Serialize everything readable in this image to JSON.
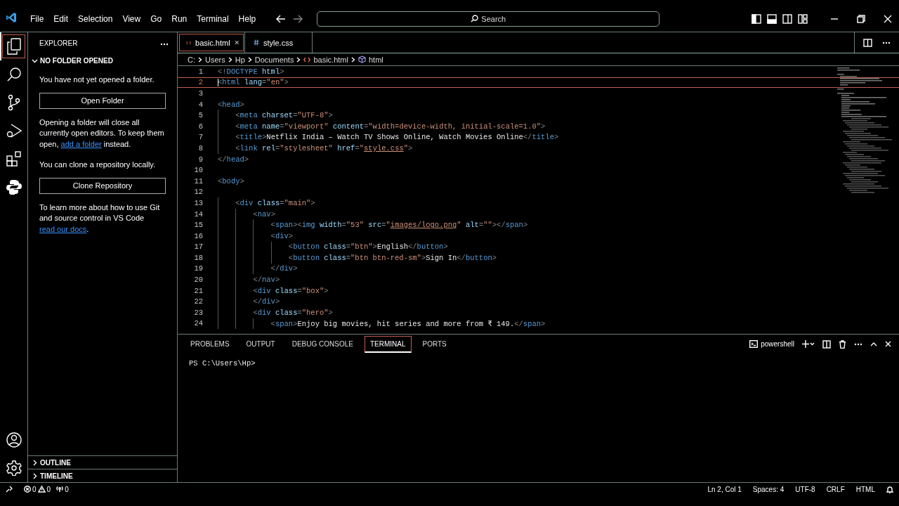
{
  "menu": [
    "File",
    "Edit",
    "Selection",
    "View",
    "Go",
    "Run",
    "Terminal",
    "Help"
  ],
  "search": {
    "placeholder": "Search"
  },
  "activity_bar": [
    {
      "kind": "files",
      "selected": true
    },
    {
      "kind": "search",
      "selected": false
    },
    {
      "kind": "source-control",
      "selected": false
    },
    {
      "kind": "run-debug",
      "selected": false
    },
    {
      "kind": "extensions",
      "selected": false
    },
    {
      "kind": "python",
      "selected": false
    }
  ],
  "activity_bar_bottom": [
    {
      "kind": "account"
    },
    {
      "kind": "settings"
    }
  ],
  "sidebar": {
    "title": "EXPLORER",
    "section": {
      "title": "NO FOLDER OPENED",
      "expanded": true
    },
    "blocks": [
      {
        "kind": "paragraph",
        "parts": [
          {
            "text": "You have not yet opened a folder."
          }
        ]
      },
      {
        "kind": "button",
        "label": "Open Folder"
      },
      {
        "kind": "paragraph",
        "parts": [
          {
            "text": "Opening a folder will close all currently open editors. To keep them open, "
          },
          {
            "link": "add a folder"
          },
          {
            "text": " instead."
          }
        ]
      },
      {
        "kind": "paragraph",
        "parts": [
          {
            "text": "You can clone a repository locally."
          }
        ]
      },
      {
        "kind": "button",
        "label": "Clone Repository"
      },
      {
        "kind": "paragraph",
        "parts": [
          {
            "text": "To learn more about how to use Git and source control in VS Code "
          },
          {
            "link": "read our docs"
          },
          {
            "text": "."
          }
        ]
      }
    ],
    "collapsed_sections": [
      {
        "title": "OUTLINE",
        "expanded": false
      },
      {
        "title": "TIMELINE",
        "expanded": false
      }
    ]
  },
  "tabs": [
    {
      "label": "basic.html",
      "kind": "html",
      "selected": true
    },
    {
      "label": "style.css",
      "kind": "css",
      "selected": false
    }
  ],
  "breadcrumbs": [
    {
      "label": "C:"
    },
    {
      "label": "Users"
    },
    {
      "label": "Hp"
    },
    {
      "label": "Documents"
    },
    {
      "label": "basic.html",
      "kind": "html"
    },
    {
      "label": "html",
      "kind": "element"
    }
  ],
  "code": [
    {
      "number": "1",
      "current": false,
      "tokens": [
        {
          "kind": "punct",
          "text": "<!"
        },
        {
          "kind": "tag",
          "text": "DOCTYPE"
        },
        {
          "kind": "attr",
          "text": " html"
        },
        {
          "kind": "punct",
          "text": ">"
        }
      ]
    },
    {
      "number": "2",
      "current": true,
      "tokens": [
        {
          "kind": "punct",
          "text": "<"
        },
        {
          "kind": "tag",
          "text": "html"
        },
        {
          "kind": "attr",
          "text": " lang"
        },
        {
          "kind": "punct",
          "text": "="
        },
        {
          "kind": "string",
          "text": "\"en\""
        },
        {
          "kind": "punct",
          "text": ">"
        }
      ]
    },
    {
      "number": "3",
      "current": false
    },
    {
      "number": "4",
      "current": false,
      "tokens": [
        {
          "kind": "punct",
          "text": "<"
        },
        {
          "kind": "tag",
          "text": "head"
        },
        {
          "kind": "punct",
          "text": ">"
        }
      ]
    },
    {
      "number": "5",
      "current": false,
      "tokens": [
        {
          "kind": "punct",
          "text": "    <"
        },
        {
          "kind": "tag",
          "text": "meta"
        },
        {
          "kind": "attr",
          "text": " charset"
        },
        {
          "kind": "punct",
          "text": "="
        },
        {
          "kind": "string",
          "text": "\"UTF-8\""
        },
        {
          "kind": "punct",
          "text": ">"
        }
      ]
    },
    {
      "number": "6",
      "current": false,
      "tokens": [
        {
          "kind": "punct",
          "text": "    <"
        },
        {
          "kind": "tag",
          "text": "meta"
        },
        {
          "kind": "attr",
          "text": " name"
        },
        {
          "kind": "punct",
          "text": "="
        },
        {
          "kind": "string",
          "text": "\"viewport\""
        },
        {
          "kind": "attr",
          "text": " content"
        },
        {
          "kind": "punct",
          "text": "="
        },
        {
          "kind": "string",
          "text": "\"width=device-width, initial-scale=1.0\""
        },
        {
          "kind": "punct",
          "text": ">"
        }
      ]
    },
    {
      "number": "7",
      "current": false,
      "tokens": [
        {
          "kind": "punct",
          "text": "    <"
        },
        {
          "kind": "tag",
          "text": "title"
        },
        {
          "kind": "punct",
          "text": ">"
        },
        {
          "kind": "text",
          "text": "Netflix India – Watch TV Shows Online, Watch Movies Online"
        },
        {
          "kind": "punct",
          "text": "</"
        },
        {
          "kind": "tag",
          "text": "title"
        },
        {
          "kind": "punct",
          "text": ">"
        }
      ]
    },
    {
      "number": "8",
      "current": false,
      "tokens": [
        {
          "kind": "punct",
          "text": "    <"
        },
        {
          "kind": "tag",
          "text": "link"
        },
        {
          "kind": "attr",
          "text": " rel"
        },
        {
          "kind": "punct",
          "text": "="
        },
        {
          "kind": "string",
          "text": "\"stylesheet\""
        },
        {
          "kind": "attr",
          "text": " href"
        },
        {
          "kind": "punct",
          "text": "="
        },
        {
          "kind": "string",
          "text": "\""
        },
        {
          "kind": "link",
          "text": "style.css"
        },
        {
          "kind": "string",
          "text": "\""
        },
        {
          "kind": "punct",
          "text": ">"
        }
      ]
    },
    {
      "number": "9",
      "current": false,
      "tokens": [
        {
          "kind": "punct",
          "text": "</"
        },
        {
          "kind": "tag",
          "text": "head"
        },
        {
          "kind": "punct",
          "text": ">"
        }
      ]
    },
    {
      "number": "10",
      "current": false
    },
    {
      "number": "11",
      "current": false,
      "tokens": [
        {
          "kind": "punct",
          "text": "<"
        },
        {
          "kind": "tag",
          "text": "body"
        },
        {
          "kind": "punct",
          "text": ">"
        }
      ]
    },
    {
      "number": "12",
      "current": false
    },
    {
      "number": "13",
      "current": false,
      "tokens": [
        {
          "kind": "punct",
          "text": "    <"
        },
        {
          "kind": "tag",
          "text": "div"
        },
        {
          "kind": "attr",
          "text": " class"
        },
        {
          "kind": "punct",
          "text": "="
        },
        {
          "kind": "string",
          "text": "\"main\""
        },
        {
          "kind": "punct",
          "text": ">"
        }
      ]
    },
    {
      "number": "14",
      "current": false,
      "tokens": [
        {
          "kind": "punct",
          "text": "        <"
        },
        {
          "kind": "tag",
          "text": "nav"
        },
        {
          "kind": "punct",
          "text": ">"
        }
      ]
    },
    {
      "number": "15",
      "current": false,
      "tokens": [
        {
          "kind": "punct",
          "text": "            <"
        },
        {
          "kind": "tag",
          "text": "span"
        },
        {
          "kind": "punct",
          "text": "><"
        },
        {
          "kind": "tag",
          "text": "img"
        },
        {
          "kind": "attr",
          "text": " width"
        },
        {
          "kind": "punct",
          "text": "="
        },
        {
          "kind": "string",
          "text": "\"53\""
        },
        {
          "kind": "attr",
          "text": " src"
        },
        {
          "kind": "punct",
          "text": "="
        },
        {
          "kind": "string",
          "text": "\""
        },
        {
          "kind": "link",
          "text": "images/logo.png"
        },
        {
          "kind": "string",
          "text": "\""
        },
        {
          "kind": "attr",
          "text": " alt"
        },
        {
          "kind": "punct",
          "text": "="
        },
        {
          "kind": "string",
          "text": "\"\""
        },
        {
          "kind": "punct",
          "text": "></"
        },
        {
          "kind": "tag",
          "text": "span"
        },
        {
          "kind": "punct",
          "text": ">"
        }
      ]
    },
    {
      "number": "16",
      "current": false,
      "tokens": [
        {
          "kind": "punct",
          "text": "            <"
        },
        {
          "kind": "tag",
          "text": "div"
        },
        {
          "kind": "punct",
          "text": ">"
        }
      ]
    },
    {
      "number": "17",
      "current": false,
      "tokens": [
        {
          "kind": "punct",
          "text": "                <"
        },
        {
          "kind": "tag",
          "text": "button"
        },
        {
          "kind": "attr",
          "text": " class"
        },
        {
          "kind": "punct",
          "text": "="
        },
        {
          "kind": "string",
          "text": "\"btn\""
        },
        {
          "kind": "punct",
          "text": ">"
        },
        {
          "kind": "text",
          "text": "English"
        },
        {
          "kind": "punct",
          "text": "</"
        },
        {
          "kind": "tag",
          "text": "button"
        },
        {
          "kind": "punct",
          "text": ">"
        }
      ]
    },
    {
      "number": "18",
      "current": false,
      "tokens": [
        {
          "kind": "punct",
          "text": "                <"
        },
        {
          "kind": "tag",
          "text": "button"
        },
        {
          "kind": "attr",
          "text": " class"
        },
        {
          "kind": "punct",
          "text": "="
        },
        {
          "kind": "string",
          "text": "\"btn btn-red-sm\""
        },
        {
          "kind": "punct",
          "text": ">"
        },
        {
          "kind": "text",
          "text": "Sign In"
        },
        {
          "kind": "punct",
          "text": "</"
        },
        {
          "kind": "tag",
          "text": "button"
        },
        {
          "kind": "punct",
          "text": ">"
        }
      ]
    },
    {
      "number": "19",
      "current": false,
      "tokens": [
        {
          "kind": "punct",
          "text": "            </"
        },
        {
          "kind": "tag",
          "text": "div"
        },
        {
          "kind": "punct",
          "text": ">"
        }
      ]
    },
    {
      "number": "20",
      "current": false,
      "tokens": [
        {
          "kind": "punct",
          "text": "        </"
        },
        {
          "kind": "tag",
          "text": "nav"
        },
        {
          "kind": "punct",
          "text": ">"
        }
      ]
    },
    {
      "number": "21",
      "current": false,
      "tokens": [
        {
          "kind": "punct",
          "text": "        <"
        },
        {
          "kind": "tag",
          "text": "div"
        },
        {
          "kind": "attr",
          "text": " class"
        },
        {
          "kind": "punct",
          "text": "="
        },
        {
          "kind": "string",
          "text": "\"box\""
        },
        {
          "kind": "punct",
          "text": ">"
        }
      ]
    },
    {
      "number": "22",
      "current": false,
      "tokens": [
        {
          "kind": "punct",
          "text": "        </"
        },
        {
          "kind": "tag",
          "text": "div"
        },
        {
          "kind": "punct",
          "text": ">"
        }
      ]
    },
    {
      "number": "23",
      "current": false,
      "tokens": [
        {
          "kind": "punct",
          "text": "        <"
        },
        {
          "kind": "tag",
          "text": "div"
        },
        {
          "kind": "attr",
          "text": " class"
        },
        {
          "kind": "punct",
          "text": "="
        },
        {
          "kind": "string",
          "text": "\"hero\""
        },
        {
          "kind": "punct",
          "text": ">"
        }
      ]
    },
    {
      "number": "24",
      "current": false,
      "tokens": [
        {
          "kind": "punct",
          "text": "            <"
        },
        {
          "kind": "tag",
          "text": "span"
        },
        {
          "kind": "punct",
          "text": ">"
        },
        {
          "kind": "text",
          "text": "Enjoy big movies, hit series and more from ₹ 149."
        },
        {
          "kind": "punct",
          "text": "</"
        },
        {
          "kind": "tag",
          "text": "span"
        },
        {
          "kind": "punct",
          "text": ">"
        }
      ]
    }
  ],
  "panel": {
    "tabs": [
      {
        "label": "PROBLEMS",
        "selected": false
      },
      {
        "label": "OUTPUT",
        "selected": false
      },
      {
        "label": "DEBUG CONSOLE",
        "selected": false
      },
      {
        "label": "TERMINAL",
        "selected": true
      },
      {
        "label": "PORTS",
        "selected": false
      }
    ],
    "shell": "powershell",
    "terminal_lines": [
      "PS C:\\Users\\Hp>"
    ]
  },
  "status_bar": {
    "errors": "0",
    "warnings": "0",
    "ports": "0",
    "items": [
      "Ln 2, Col 1",
      "Spaces: 4",
      "UTF-8",
      "CRLF",
      "HTML"
    ]
  }
}
